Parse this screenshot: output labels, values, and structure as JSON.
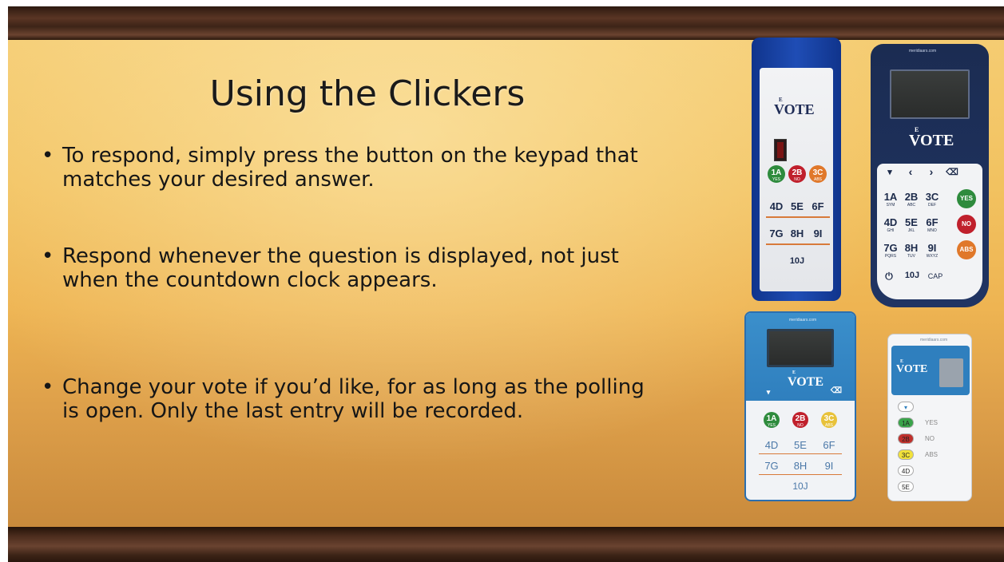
{
  "slide": {
    "title": "Using the Clickers",
    "bullets": [
      "To respond, simply press the button on the keypad that matches your desired answer.",
      "Respond whenever the question is displayed, not just when the countdown clock appears.",
      "Change your vote if you’d like, for as long as the polling is open. Only the last entry will be recorded."
    ],
    "bullet_glyph": "•"
  },
  "clickers": {
    "brand": "VOTE",
    "brand_prefix": "E",
    "site": "meridiaars.com",
    "device1": {
      "round_keys": [
        {
          "label": "1A",
          "sub": "YES"
        },
        {
          "label": "2B",
          "sub": "NO"
        },
        {
          "label": "3C",
          "sub": "ABS"
        }
      ],
      "keys": [
        "4D",
        "5E",
        "6F",
        "7G",
        "8H",
        "9I",
        "10J"
      ]
    },
    "device2": {
      "nav_keys": [
        "▾",
        "‹",
        "›",
        "⌫"
      ],
      "keys": [
        {
          "label": "1A",
          "sub": "SYM"
        },
        {
          "label": "2B",
          "sub": "ABC"
        },
        {
          "label": "3C",
          "sub": "DEF"
        },
        {
          "label": "4D",
          "sub": "GHI"
        },
        {
          "label": "5E",
          "sub": "JKL"
        },
        {
          "label": "6F",
          "sub": "MNO"
        },
        {
          "label": "7G",
          "sub": "PQRS"
        },
        {
          "label": "8H",
          "sub": "TUV"
        },
        {
          "label": "9I",
          "sub": "WXYZ"
        }
      ],
      "side_keys": [
        "YES",
        "NO",
        "ABS"
      ],
      "bottom_keys": [
        "⏻",
        "10J",
        "CAP"
      ]
    },
    "device3": {
      "round_keys": [
        {
          "label": "1A",
          "sub": "YES"
        },
        {
          "label": "2B",
          "sub": "NO"
        },
        {
          "label": "3C",
          "sub": "ABS"
        }
      ],
      "keys": [
        "4D",
        "5E",
        "6F",
        "7G",
        "8H",
        "9I",
        "10J"
      ]
    },
    "device4": {
      "pills": [
        "1A",
        "2B",
        "3C",
        "4D",
        "5E"
      ],
      "labels": [
        "YES",
        "NO",
        "ABS"
      ]
    }
  }
}
